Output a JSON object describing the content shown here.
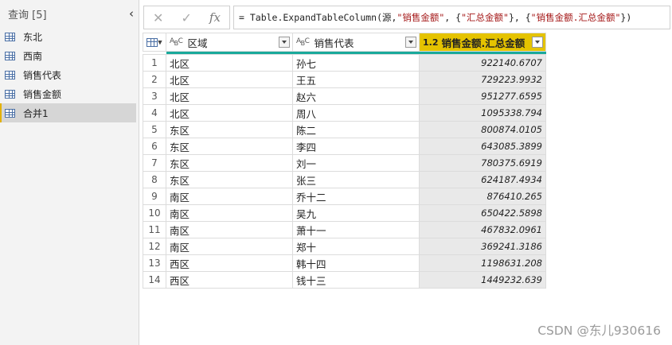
{
  "queries_pane": {
    "header": "查询 [5]",
    "collapse_icon": "chevron-left-icon",
    "items": [
      {
        "label": "东北",
        "selected": false
      },
      {
        "label": "西南",
        "selected": false
      },
      {
        "label": "销售代表",
        "selected": false
      },
      {
        "label": "销售金额",
        "selected": false
      },
      {
        "label": "合并1",
        "selected": true
      }
    ]
  },
  "formula_bar": {
    "cancel_icon": "✕",
    "confirm_icon": "✓",
    "fx_label": "fx",
    "formula_prefix": "= Table.ExpandTableColumn(源, ",
    "formula_str1": "\"销售金额\"",
    "formula_mid1": ", {",
    "formula_str2": "\"汇总金额\"",
    "formula_mid2": "}, {",
    "formula_str3": "\"销售金额.汇总金额\"",
    "formula_suffix": "})"
  },
  "grid": {
    "columns": [
      {
        "label": "区域",
        "type": "ABC"
      },
      {
        "label": "销售代表",
        "type": "ABC"
      },
      {
        "label": "销售金额.汇总金额",
        "type": "1.2"
      }
    ],
    "accent_color": "#1aa99b",
    "selected_header_color": "#e5c300",
    "rows": [
      {
        "n": "1",
        "region": "北区",
        "rep": "孙七",
        "amount": "922140.6707"
      },
      {
        "n": "2",
        "region": "北区",
        "rep": "王五",
        "amount": "729223.9932"
      },
      {
        "n": "3",
        "region": "北区",
        "rep": "赵六",
        "amount": "951277.6595"
      },
      {
        "n": "4",
        "region": "北区",
        "rep": "周八",
        "amount": "1095338.794"
      },
      {
        "n": "5",
        "region": "东区",
        "rep": "陈二",
        "amount": "800874.0105"
      },
      {
        "n": "6",
        "region": "东区",
        "rep": "李四",
        "amount": "643085.3899"
      },
      {
        "n": "7",
        "region": "东区",
        "rep": "刘一",
        "amount": "780375.6919"
      },
      {
        "n": "8",
        "region": "东区",
        "rep": "张三",
        "amount": "624187.4934"
      },
      {
        "n": "9",
        "region": "南区",
        "rep": "乔十二",
        "amount": "876410.265"
      },
      {
        "n": "10",
        "region": "南区",
        "rep": "吴九",
        "amount": "650422.5898"
      },
      {
        "n": "11",
        "region": "南区",
        "rep": "萧十一",
        "amount": "467832.0961"
      },
      {
        "n": "12",
        "region": "南区",
        "rep": "郑十",
        "amount": "369241.3186"
      },
      {
        "n": "13",
        "region": "西区",
        "rep": "韩十四",
        "amount": "1198631.208"
      },
      {
        "n": "14",
        "region": "西区",
        "rep": "钱十三",
        "amount": "1449232.639"
      }
    ]
  },
  "watermark": "CSDN @东儿930616"
}
